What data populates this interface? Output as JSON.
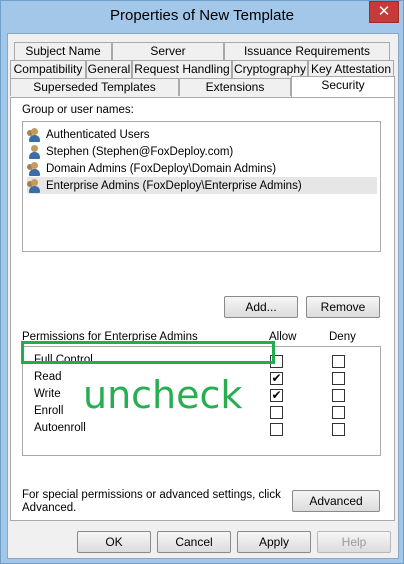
{
  "window": {
    "title": "Properties of New Template",
    "close_glyph": "✕"
  },
  "tabs": {
    "row1": [
      "Subject Name",
      "Server",
      "Issuance Requirements"
    ],
    "row2": [
      "Compatibility",
      "General",
      "Request Handling",
      "Cryptography",
      "Key Attestation"
    ],
    "row3": [
      "Superseded Templates",
      "Extensions",
      "Security"
    ],
    "active": "Security"
  },
  "security": {
    "group_label": "Group or user names:",
    "users": [
      {
        "name": "Authenticated Users",
        "icon": "group-users-icon"
      },
      {
        "name": "Stephen (Stephen@FoxDeploy.com)",
        "icon": "user-icon"
      },
      {
        "name": "Domain Admins (FoxDeploy\\Domain Admins)",
        "icon": "group-users-icon"
      },
      {
        "name": "Enterprise Admins (FoxDeploy\\Enterprise Admins)",
        "icon": "group-users-icon",
        "selected": true
      }
    ],
    "add_label": "Add...",
    "remove_label": "Remove",
    "permissions_label": "Permissions for Enterprise Admins",
    "allow_label": "Allow",
    "deny_label": "Deny",
    "permissions": [
      {
        "name": "Full Control",
        "allow": false,
        "deny": false
      },
      {
        "name": "Read",
        "allow": true,
        "deny": false
      },
      {
        "name": "Write",
        "allow": true,
        "deny": false
      },
      {
        "name": "Enroll",
        "allow": false,
        "deny": false
      },
      {
        "name": "Autoenroll",
        "allow": false,
        "deny": false
      }
    ],
    "advanced_text": "For special permissions or advanced settings, click Advanced.",
    "advanced_label": "Advanced"
  },
  "footer": {
    "ok": "OK",
    "cancel": "Cancel",
    "apply": "Apply",
    "help": "Help"
  },
  "annotation": {
    "text": "uncheck",
    "color": "#27ae51"
  },
  "check_glyph": "✔"
}
